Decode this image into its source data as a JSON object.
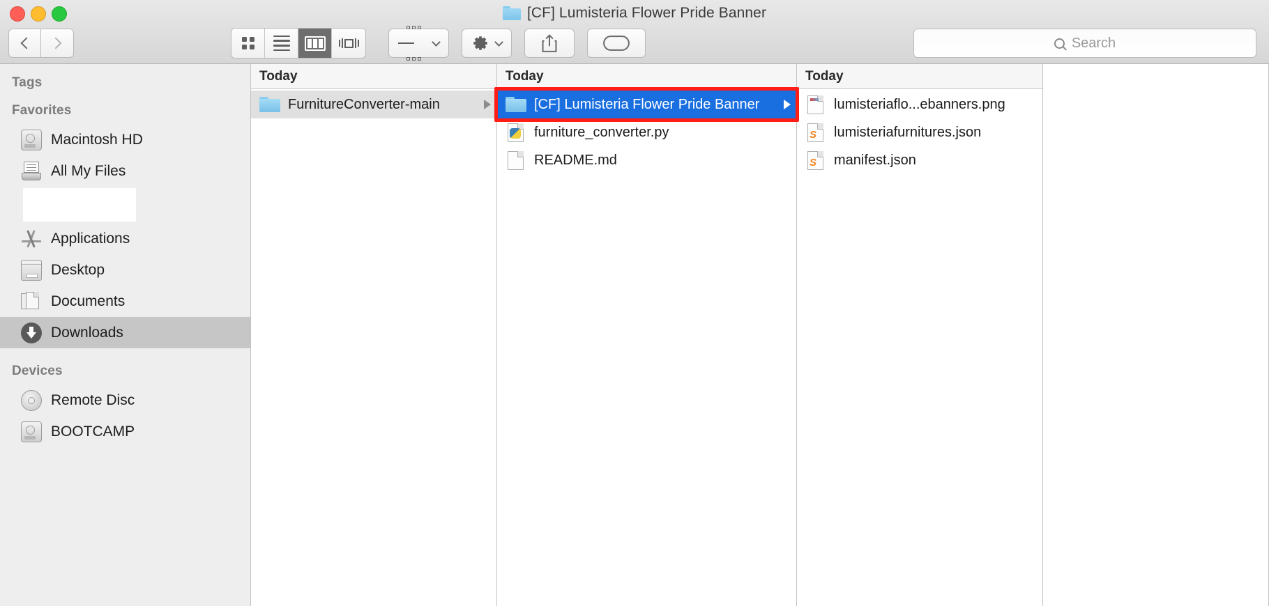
{
  "window": {
    "title": "[CF] Lumisteria Flower Pride Banner",
    "title_icon": "folder-icon",
    "traffic_lights": [
      "close-button",
      "minimize-button",
      "zoom-button"
    ]
  },
  "toolbar": {
    "back_label": "Back",
    "forward_label": "Forward",
    "views": [
      {
        "name": "icon-view",
        "label": "Icon View",
        "active": false
      },
      {
        "name": "list-view",
        "label": "List View",
        "active": false
      },
      {
        "name": "column-view",
        "label": "Column View",
        "active": true
      },
      {
        "name": "coverflow-view",
        "label": "Cover Flow View",
        "active": false
      }
    ],
    "arrange_label": "Arrange",
    "action_label": "Action",
    "share_label": "Share",
    "tags_label": "Edit Tags"
  },
  "search": {
    "placeholder": "Search",
    "value": ""
  },
  "sidebar": {
    "sections": [
      {
        "heading": "Tags",
        "items": []
      },
      {
        "heading": "Favorites",
        "items": [
          {
            "label": "Macintosh HD",
            "icon": "hard-drive-icon",
            "selected": false
          },
          {
            "label": "All My Files",
            "icon": "all-my-files-icon",
            "selected": false
          },
          {
            "label": "",
            "icon": "blank-item",
            "selected": false,
            "blank": true
          },
          {
            "label": "Applications",
            "icon": "applications-icon",
            "selected": false
          },
          {
            "label": "Desktop",
            "icon": "desktop-icon",
            "selected": false
          },
          {
            "label": "Documents",
            "icon": "documents-icon",
            "selected": false
          },
          {
            "label": "Downloads",
            "icon": "downloads-icon",
            "selected": true
          }
        ]
      },
      {
        "heading": "Devices",
        "items": [
          {
            "label": "Remote Disc",
            "icon": "optical-disc-icon",
            "selected": false
          },
          {
            "label": "BOOTCAMP",
            "icon": "hard-drive-icon",
            "selected": false
          }
        ]
      }
    ]
  },
  "columns": [
    {
      "header": "Today",
      "items": [
        {
          "name": "FurnitureConverter-main",
          "icon": "folder-icon",
          "state": "grey-selected",
          "has_disclosure": true,
          "annotated": false
        }
      ]
    },
    {
      "header": "Today",
      "items": [
        {
          "name": "[CF] Lumisteria Flower Pride Banner",
          "icon": "folder-icon",
          "state": "blue-selected",
          "has_disclosure": true,
          "annotated": true
        },
        {
          "name": "furniture_converter.py",
          "icon": "python-file-icon",
          "state": "none",
          "has_disclosure": false,
          "annotated": false
        },
        {
          "name": "README.md",
          "icon": "document-file-icon",
          "state": "none",
          "has_disclosure": false,
          "annotated": false
        }
      ]
    },
    {
      "header": "Today",
      "items": [
        {
          "name": "lumisteriaflo...ebanners.png",
          "icon": "image-file-icon",
          "state": "none",
          "has_disclosure": false,
          "annotated": false
        },
        {
          "name": "lumisteriafurnitures.json",
          "icon": "sublime-file-icon",
          "state": "none",
          "has_disclosure": false,
          "annotated": false
        },
        {
          "name": "manifest.json",
          "icon": "sublime-file-icon",
          "state": "none",
          "has_disclosure": false,
          "annotated": false
        }
      ]
    }
  ],
  "colors": {
    "selection_blue": "#1a6fe0",
    "annotation_red": "#ff1d15",
    "sidebar_bg": "#eeeeee",
    "folder_blue": "#8ccdef"
  }
}
